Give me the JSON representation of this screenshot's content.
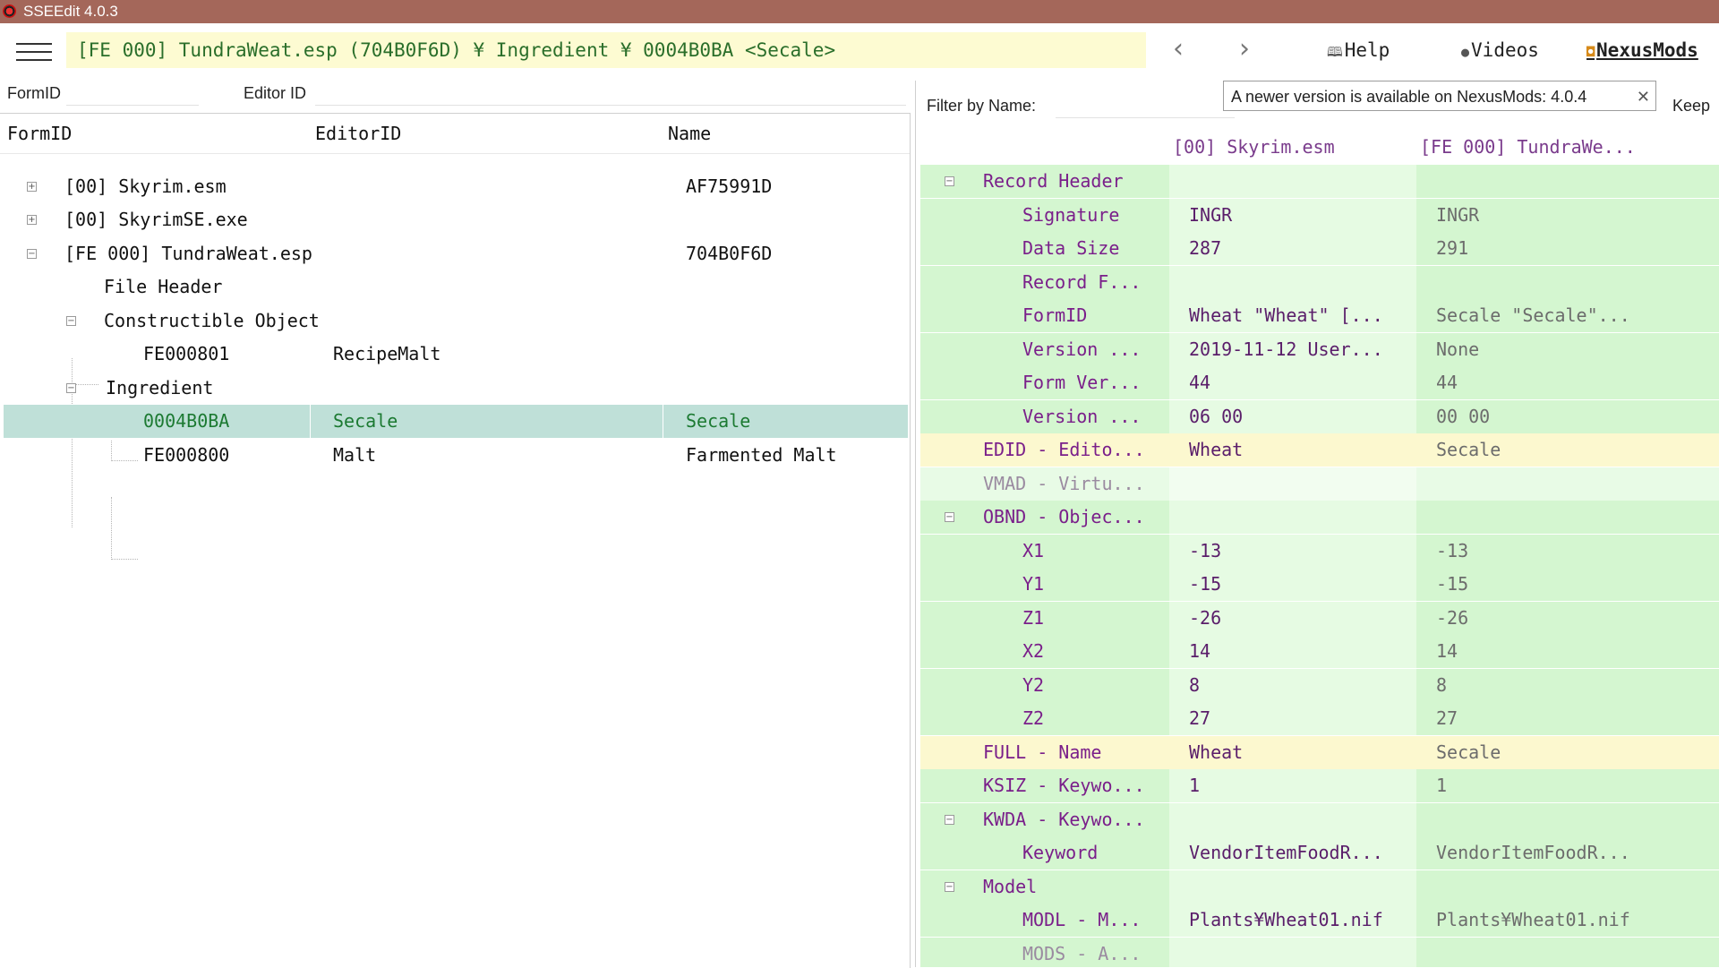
{
  "window": {
    "title": "SSEEdit 4.0.3"
  },
  "toolbar": {
    "path": "[FE 000] TundraWeat.esp (704B0F6D) ¥ Ingredient ¥ 0004B0BA <Secale>",
    "back_glyph": "‹",
    "forward_glyph": "›",
    "help_label": "Help",
    "videos_label": "Videos",
    "nexus_label": "NexusMods",
    "help_icon": "book-icon",
    "videos_icon": "dot-icon",
    "nexus_icon": "nexus-icon"
  },
  "filters": {
    "formid_label": "FormID",
    "formid_value": "",
    "editorid_label": "Editor ID",
    "editorid_value": "",
    "filter_by_name_label": "Filter by Name:",
    "filter_by_name_value": "",
    "keep_label": "Keep"
  },
  "tooltip": {
    "text": "A newer version is available on NexusMods: 4.0.4",
    "close": "✕"
  },
  "tree": {
    "columns": [
      "FormID",
      "EditorID",
      "Name"
    ],
    "rows": [
      {
        "formid": "[00] Skyrim.esm",
        "editorid": "",
        "name": "AF75991D",
        "expander": "+"
      },
      {
        "formid": "[00] SkyrimSE.exe",
        "editorid": "",
        "name": "",
        "expander": "+"
      },
      {
        "formid": "[FE 000] TundraWeat.esp",
        "editorid": "",
        "name": "704B0F6D",
        "expander": "−"
      },
      {
        "formid": "File Header",
        "editorid": "",
        "name": "",
        "expander": ""
      },
      {
        "formid": "Constructible Object",
        "editorid": "",
        "name": "",
        "expander": "−"
      },
      {
        "formid": "FE000801",
        "editorid": "RecipeMalt",
        "name": "",
        "expander": ""
      },
      {
        "formid": "Ingredient",
        "editorid": "",
        "name": "",
        "expander": "−"
      },
      {
        "formid": "0004B0BA",
        "editorid": "Secale",
        "name": "Secale",
        "expander": ""
      },
      {
        "formid": "FE000800",
        "editorid": "Malt",
        "name": "Farmented Malt",
        "expander": ""
      }
    ]
  },
  "record_view": {
    "columns": [
      "[00] Skyrim.esm",
      "[FE 000] TundraWe..."
    ],
    "colors": {
      "green": "#d4f6d0",
      "light_green": "#e8fbe6",
      "yellow": "#fcf8cf"
    },
    "rows": [
      {
        "label": "Record Header",
        "v1": "",
        "v2": ""
      },
      {
        "label": "Signature",
        "v1": "INGR",
        "v2": "INGR"
      },
      {
        "label": "Data Size",
        "v1": "287",
        "v2": "291"
      },
      {
        "label": "Record F...",
        "v1": "",
        "v2": ""
      },
      {
        "label": "FormID",
        "v1": "Wheat \"Wheat\" [...",
        "v2": "Secale \"Secale\"..."
      },
      {
        "label": "Version ...",
        "v1": "2019-11-12 User...",
        "v2": "None"
      },
      {
        "label": "Form Ver...",
        "v1": "44",
        "v2": "44"
      },
      {
        "label": "Version ...",
        "v1": "06 00",
        "v2": "00 00"
      },
      {
        "label": "EDID - Edito...",
        "v1": "Wheat",
        "v2": "Secale"
      },
      {
        "label": "VMAD - Virtu...",
        "v1": "",
        "v2": ""
      },
      {
        "label": "OBND - Objec...",
        "v1": "",
        "v2": ""
      },
      {
        "label": "X1",
        "v1": "-13",
        "v2": "-13"
      },
      {
        "label": "Y1",
        "v1": "-15",
        "v2": "-15"
      },
      {
        "label": "Z1",
        "v1": "-26",
        "v2": "-26"
      },
      {
        "label": "X2",
        "v1": "14",
        "v2": "14"
      },
      {
        "label": "Y2",
        "v1": "8",
        "v2": "8"
      },
      {
        "label": "Z2",
        "v1": "27",
        "v2": "27"
      },
      {
        "label": "FULL - Name",
        "v1": "Wheat",
        "v2": "Secale"
      },
      {
        "label": "KSIZ - Keywo...",
        "v1": "1",
        "v2": "1"
      },
      {
        "label": "KWDA - Keywo...",
        "v1": "",
        "v2": ""
      },
      {
        "label": "Keyword",
        "v1": "VendorItemFoodR...",
        "v2": "VendorItemFoodR..."
      },
      {
        "label": "Model",
        "v1": "",
        "v2": ""
      },
      {
        "label": "MODL - M...",
        "v1": "Plants¥Wheat01.nif",
        "v2": "Plants¥Wheat01.nif"
      },
      {
        "label": "MODS - A...",
        "v1": "",
        "v2": ""
      }
    ]
  }
}
